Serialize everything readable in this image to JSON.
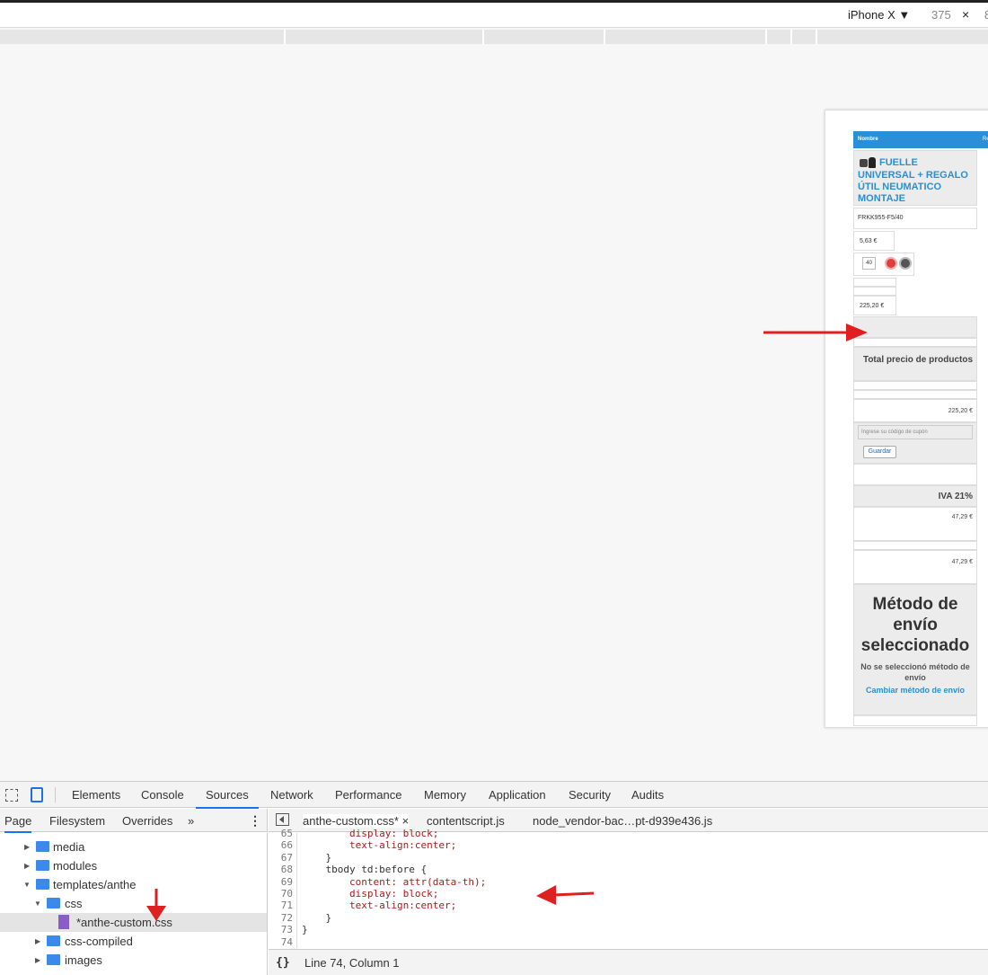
{
  "device_toolbar": {
    "device": "iPhone X ▼",
    "width": "375",
    "close": "×",
    "height_partial": "8"
  },
  "page": {
    "table_header": "Nombre",
    "table_header_next": "Re",
    "product_name": "FUELLE UNIVERSAL + REGALO ÚTIL NEUMATICO MONTAJE",
    "reference": "FRKK955-F5/40",
    "unit_price": "5,63 €",
    "quantity": "40",
    "line_total": "225,20 €",
    "total_label": "Total precio de productos",
    "total_value": "225,20 €",
    "coupon_placeholder": "Ingrese su código de cupón",
    "save_label": "Guardar",
    "tax_label": "IVA 21%",
    "tax_value": "47,29 €",
    "tax_value2": "47,29 €",
    "shipping_title": "Método de envío seleccionado",
    "shipping_none": "No se seleccionó método de envío",
    "shipping_change": "Cambiar método de envío"
  },
  "devtools": {
    "tabs": [
      "Elements",
      "Console",
      "Sources",
      "Network",
      "Performance",
      "Memory",
      "Application",
      "Security",
      "Audits"
    ],
    "active_tab": "Sources",
    "nav_tabs": [
      "Page",
      "Filesystem",
      "Overrides",
      "»"
    ],
    "tree": [
      {
        "label": "media",
        "type": "folder",
        "expanded": false,
        "depth": 1
      },
      {
        "label": "modules",
        "type": "folder",
        "expanded": false,
        "depth": 1
      },
      {
        "label": "templates/anthe",
        "type": "folder",
        "expanded": true,
        "depth": 1
      },
      {
        "label": "css",
        "type": "folder",
        "expanded": true,
        "depth": 2
      },
      {
        "label": "*anthe-custom.css",
        "type": "file",
        "depth": 3,
        "selected": true
      },
      {
        "label": "css-compiled",
        "type": "folder",
        "expanded": false,
        "depth": 2
      },
      {
        "label": "images",
        "type": "folder",
        "expanded": false,
        "depth": 2
      }
    ],
    "editor_tabs": [
      "anthe-custom.css*",
      "contentscript.js",
      "node_vendor-bac…pt-d939e436.js"
    ],
    "editor_tab_close": "×",
    "code_lines": [
      {
        "num": "65",
        "text": "        display: block;"
      },
      {
        "num": "66",
        "text": "        text-align:center;"
      },
      {
        "num": "67",
        "text": "    }"
      },
      {
        "num": "68",
        "text": "    tbody td:before {"
      },
      {
        "num": "69",
        "text": "        content: attr(data-th);"
      },
      {
        "num": "70",
        "text": "        display: block;"
      },
      {
        "num": "71",
        "text": "        text-align:center;"
      },
      {
        "num": "72",
        "text": "    }"
      },
      {
        "num": "73",
        "text": "}"
      },
      {
        "num": "74",
        "text": ""
      }
    ],
    "status_brace": "{}",
    "status_position": "Line 74, Column 1"
  },
  "colors": {
    "accent": "#1a73e8",
    "arrow": "#e02020",
    "header_blue": "#2a8fd6",
    "link_blue": "#2b8fd0"
  }
}
